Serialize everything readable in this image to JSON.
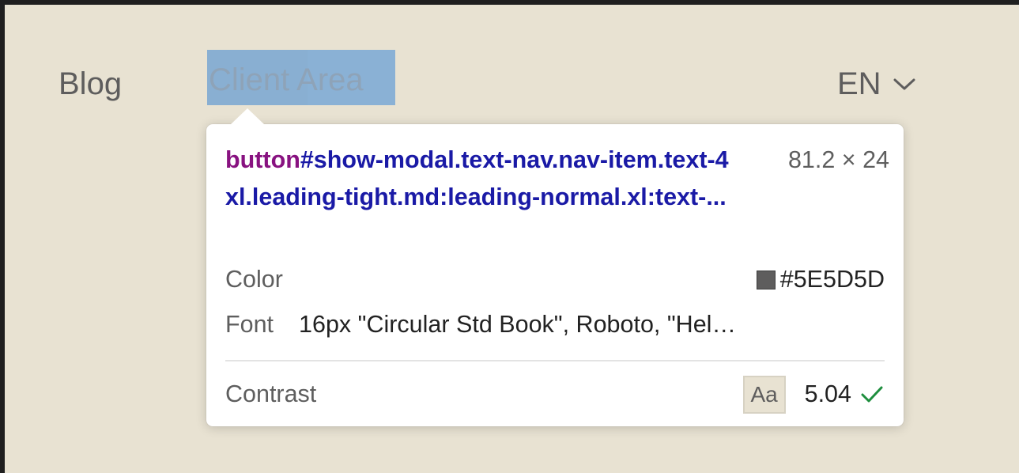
{
  "nav": {
    "blog_label": "Blog",
    "client_area_label": "Client Area",
    "language": {
      "code": "EN",
      "icon": "chevron-down-icon"
    }
  },
  "inspector_tooltip": {
    "selector_tag": "button",
    "selector_rest": "#show-modal.text-nav.nav-item.text-4xl.leading-tight.md:leading-normal.xl:text-...",
    "dimensions": "81.2 × 24",
    "color_label": "Color",
    "color_value": "#5E5D5D",
    "font_label": "Font",
    "font_value": "16px \"Circular Std Book\", Roboto, \"Hel…",
    "contrast_label": "Contrast",
    "contrast_sample": "Aa",
    "contrast_value": "5.04",
    "contrast_status_icon": "checkmark-icon"
  },
  "colors": {
    "page_background": "#e8e2d2",
    "text": "#5e5d5d",
    "selection_highlight": "#6ea0d2",
    "selector_tag": "#881280",
    "selector_text": "#1a1aa6",
    "check": "#1e8e3e"
  }
}
